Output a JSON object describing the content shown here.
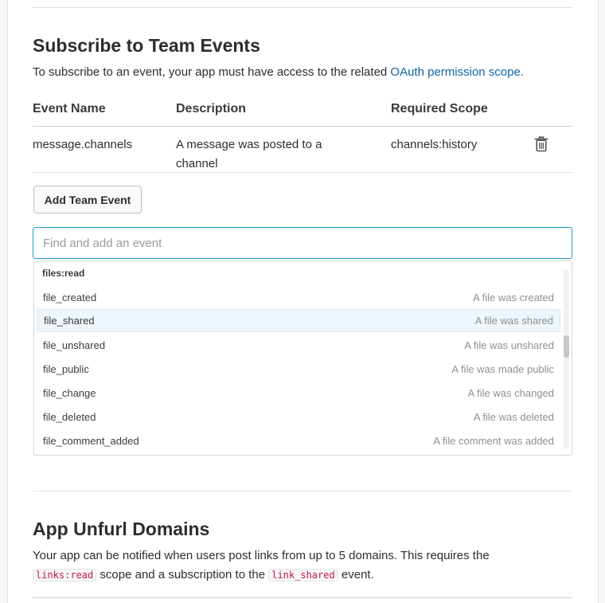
{
  "team_events": {
    "title": "Subscribe to Team Events",
    "desc_prefix": "To subscribe to an event, your app must have access to the related ",
    "desc_link": "OAuth permission scope.",
    "headers": {
      "event_name": "Event Name",
      "description": "Description",
      "required_scope": "Required Scope"
    },
    "rows": [
      {
        "event_name": "message.channels",
        "description": "A message was posted to a channel",
        "required_scope": "channels:history"
      }
    ],
    "add_button": "Add Team Event",
    "search": {
      "placeholder": "Find and add an event",
      "value": ""
    },
    "dropdown": {
      "group": "files:read",
      "options": [
        {
          "name": "file_created",
          "desc": "A file was created"
        },
        {
          "name": "file_shared",
          "desc": "A file was shared",
          "highlighted": true
        },
        {
          "name": "file_unshared",
          "desc": "A file was unshared"
        },
        {
          "name": "file_public",
          "desc": "A file was made public"
        },
        {
          "name": "file_change",
          "desc": "A file was changed"
        },
        {
          "name": "file_deleted",
          "desc": "A file was deleted"
        },
        {
          "name": "file_comment_added",
          "desc": "A file comment was added"
        }
      ]
    }
  },
  "unfurl": {
    "title": "App Unfurl Domains",
    "line1": "Your app can be notified when users post links from up to 5 domains. This requires the",
    "code_scope": "links:read",
    "mid_text": " scope and a subscription to the ",
    "code_event": "link_shared",
    "end_text": " event."
  },
  "icons": {
    "delete": "trash-icon"
  },
  "colors": {
    "link": "#1264a3",
    "focus_border": "#1d9bd1",
    "highlight_bg": "#eef5fb",
    "code_text": "#c4174a"
  }
}
